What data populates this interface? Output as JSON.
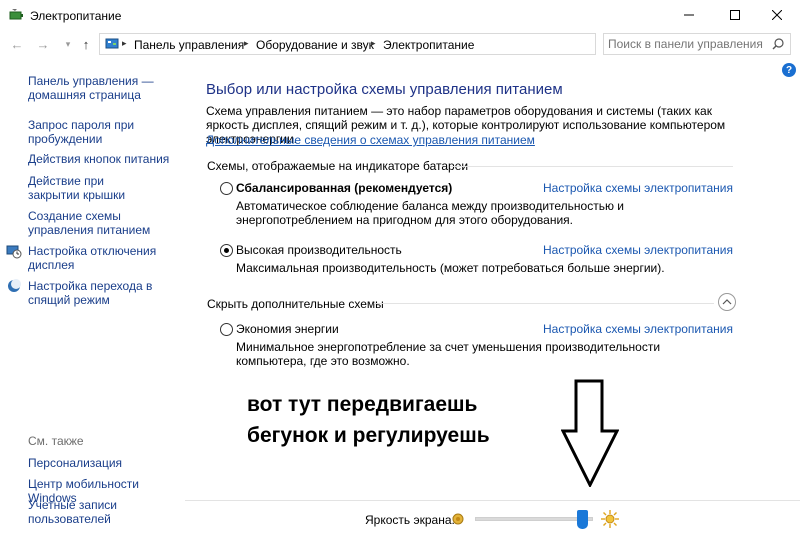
{
  "window": {
    "title": "Электропитание"
  },
  "address": {
    "breadcrumbs": [
      "Панель управления",
      "Оборудование и звук",
      "Электропитание"
    ],
    "search_placeholder": "Поиск в панели управления"
  },
  "sidebar": {
    "links": [
      "Панель управления — домашняя страница",
      "Запрос пароля при пробуждении",
      "Действия кнопок питания",
      "Действие при закрытии крышки",
      "Создание схемы управления питанием",
      "Настройка отключения дисплея",
      "Настройка перехода в спящий режим"
    ],
    "see_also_heading": "См. также",
    "see_also": [
      "Персонализация",
      "Центр мобильности Windows",
      "Учетные записи пользователей"
    ]
  },
  "main": {
    "title": "Выбор или настройка схемы управления питанием",
    "description": "Схема управления питанием — это набор параметров оборудования и системы (таких как яркость дисплея, спящий режим и т. д.), которые контролируют использование компьютером электроэнергии.",
    "more_link": "Дополнительные сведения о схемах управления питанием",
    "battery_group_label": "Схемы, отображаемые на индикаторе батареи",
    "hidden_group_label": "Скрыть дополнительные схемы",
    "plan_settings_link": "Настройка схемы электропитания",
    "plans": [
      {
        "name": "Сбалансированная (рекомендуется)",
        "description": "Автоматическое соблюдение баланса между производительностью и энергопотреблением на пригодном для этого оборудования.",
        "selected": false
      },
      {
        "name": "Высокая производительность",
        "description": "Максимальная производительность (может потребоваться больше энергии).",
        "selected": true
      },
      {
        "name": "Экономия энергии",
        "description": "Минимальное энергопотребление за счет уменьшения производительности компьютера, где это возможно.",
        "selected": false
      }
    ]
  },
  "annotation": {
    "line1": "вот тут передвигаешь",
    "line2": "бегунок и регулируешь"
  },
  "brightness": {
    "label": "Яркость экрана:",
    "value_fraction": 0.95
  },
  "colors": {
    "link": "#1a57b0",
    "title": "#1e3287",
    "slider_thumb": "#1a78d8"
  },
  "icons": {
    "app": "power-options-icon",
    "search": "search-icon",
    "help": "help-icon",
    "brightness_low": "sun-small-icon",
    "brightness_high": "sun-large-icon"
  }
}
